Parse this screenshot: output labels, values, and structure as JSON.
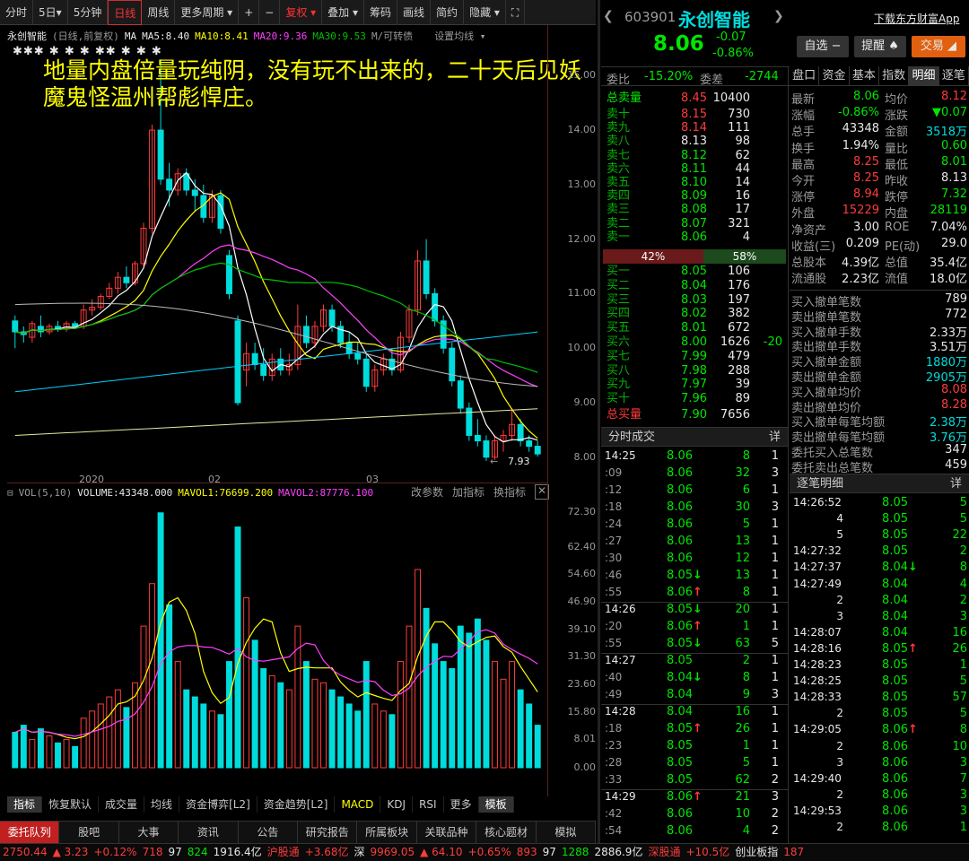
{
  "toolbar": [
    "分时",
    "5日▾",
    "5分钟",
    "日线",
    "周线",
    "更多周期 ▾",
    "+",
    "−",
    "复权 ▾",
    "叠加 ▾",
    "筹码",
    "画线",
    "简约",
    "隐藏 ▾",
    "⛶"
  ],
  "chart": {
    "name": "永创智能",
    "mode": "(日线,前复权)",
    "ma_label": "MA",
    "ma5": "MA5:8.40",
    "ma10": "MA10:8.41",
    "ma20": "MA20:9.36",
    "ma30": "MA30:9.53",
    "convert": "M/可转债",
    "settings": "设置均线 ▾",
    "markers": "✱✱✱ ✱ ✱ ✱ ✱✱ ✱ ✱ ✱",
    "overlay_text": "地量内盘倍量玩纯阴，没有玩不出来的，二十天后见妖魔鬼怪温州帮彪悍庄。",
    "price_ticks": [
      "15.00",
      "14.00",
      "13.00",
      "12.00",
      "11.00",
      "10.00",
      "9.00",
      "8.00"
    ],
    "low_label": "7.93",
    "date_labels": [
      "2020",
      "02",
      "03"
    ],
    "colors": {
      "up": "#ff3b3b",
      "down": "#00dcdc",
      "ma5": "#ffffff",
      "ma10": "#ffff00",
      "ma20": "#ff40ff",
      "ma30": "#00c000"
    }
  },
  "volume": {
    "label": "VOL(5,10)",
    "value": "VOLUME:43348.000",
    "mavol1": "MAVOL1:76699.200",
    "mavol2": "MAVOL2:87776.100",
    "edit": "改参数",
    "add": "加指标",
    "switch": "换指标",
    "ticks": [
      "72.30",
      "62.40",
      "54.60",
      "46.90",
      "39.10",
      "31.30",
      "23.60",
      "15.80",
      "8.01",
      "0.00"
    ]
  },
  "indicator_tabs": [
    "指标",
    "恢复默认",
    "成交量",
    "均线",
    "资金博弈[L2]",
    "资金趋势[L2]",
    "MACD",
    "KDJ",
    "RSI",
    "更多",
    "模板"
  ],
  "bottom_tabs": [
    "委托队列",
    "股吧",
    "大事",
    "资讯",
    "公告",
    "研究报告",
    "所属板块",
    "关联品种",
    "核心题材",
    "模拟"
  ],
  "status": [
    {
      "t": "2750.44",
      "c": "red"
    },
    {
      "t": "▲ 3.23",
      "c": "red"
    },
    {
      "t": "+0.12%",
      "c": "red"
    },
    {
      "t": "718",
      "c": "red"
    },
    {
      "t": "97",
      "c": "wht"
    },
    {
      "t": "824",
      "c": "grn"
    },
    {
      "t": "1916.4亿",
      "c": "wht"
    },
    {
      "t": "沪股通",
      "c": "red"
    },
    {
      "t": "+3.68亿",
      "c": "red"
    },
    {
      "t": "深",
      "c": "wht"
    },
    {
      "t": "9969.05",
      "c": "red"
    },
    {
      "t": "▲ 64.10",
      "c": "red"
    },
    {
      "t": "+0.65%",
      "c": "red"
    },
    {
      "t": "893",
      "c": "red"
    },
    {
      "t": "97",
      "c": "wht"
    },
    {
      "t": "1288",
      "c": "grn"
    },
    {
      "t": "2886.9亿",
      "c": "wht"
    },
    {
      "t": "深股通",
      "c": "red"
    },
    {
      "t": "+10.5亿",
      "c": "red"
    },
    {
      "t": "创业板指",
      "c": "wht"
    },
    {
      "t": "187",
      "c": "red"
    }
  ],
  "quote": {
    "code": "603901",
    "name": "永创智能",
    "download": "下载东方财富App",
    "price": "8.06",
    "change": "-0.07",
    "pct": "-0.86%",
    "btn_watch": "自选 −",
    "btn_alert": "提醒 ♠",
    "btn_trade": "交易 ◢",
    "weibi_label": "委比",
    "weibi": "-15.20%",
    "weicha_label": "委差",
    "weicha": "-2744"
  },
  "orderbook": {
    "total_sell": {
      "label": "总卖量",
      "price": "8.45",
      "vol": "10400"
    },
    "asks": [
      {
        "label": "卖十",
        "price": "8.15",
        "vol": "730",
        "c": "red"
      },
      {
        "label": "卖九",
        "price": "8.14",
        "vol": "111",
        "c": "red"
      },
      {
        "label": "卖八",
        "price": "8.13",
        "vol": "98",
        "c": "wht"
      },
      {
        "label": "卖七",
        "price": "8.12",
        "vol": "62",
        "c": "grn"
      },
      {
        "label": "卖六",
        "price": "8.11",
        "vol": "44",
        "c": "grn"
      },
      {
        "label": "卖五",
        "price": "8.10",
        "vol": "14",
        "c": "grn"
      },
      {
        "label": "卖四",
        "price": "8.09",
        "vol": "16",
        "c": "grn"
      },
      {
        "label": "卖三",
        "price": "8.08",
        "vol": "17",
        "c": "grn"
      },
      {
        "label": "卖二",
        "price": "8.07",
        "vol": "321",
        "c": "grn"
      },
      {
        "label": "卖一",
        "price": "8.06",
        "vol": "4",
        "c": "grn"
      }
    ],
    "bar_left": "42%",
    "bar_right": "58%",
    "bids": [
      {
        "label": "买一",
        "price": "8.05",
        "vol": "106",
        "c": "grn",
        "x": ""
      },
      {
        "label": "买二",
        "price": "8.04",
        "vol": "176",
        "c": "grn",
        "x": ""
      },
      {
        "label": "买三",
        "price": "8.03",
        "vol": "197",
        "c": "grn",
        "x": ""
      },
      {
        "label": "买四",
        "price": "8.02",
        "vol": "382",
        "c": "grn",
        "x": ""
      },
      {
        "label": "买五",
        "price": "8.01",
        "vol": "672",
        "c": "grn",
        "x": ""
      },
      {
        "label": "买六",
        "price": "8.00",
        "vol": "1626",
        "c": "grn",
        "x": "-20"
      },
      {
        "label": "买七",
        "price": "7.99",
        "vol": "479",
        "c": "grn",
        "x": ""
      },
      {
        "label": "买八",
        "price": "7.98",
        "vol": "288",
        "c": "grn",
        "x": ""
      },
      {
        "label": "买九",
        "price": "7.97",
        "vol": "39",
        "c": "grn",
        "x": ""
      },
      {
        "label": "买十",
        "price": "7.96",
        "vol": "89",
        "c": "grn",
        "x": ""
      }
    ],
    "total_buy": {
      "label": "总买量",
      "price": "7.90",
      "vol": "7656"
    }
  },
  "stat_tabs": [
    "盘口",
    "资金",
    "基本",
    "指数",
    "明细",
    "逐笔"
  ],
  "stats": [
    {
      "l1": "最新",
      "v1": "8.06",
      "c1": "grn",
      "l2": "均价",
      "v2": "8.12",
      "c2": "red"
    },
    {
      "l1": "涨幅",
      "v1": "-0.86%",
      "c1": "grn",
      "l2": "涨跌",
      "v2": "▼0.07",
      "c2": "grn"
    },
    {
      "l1": "总手",
      "v1": "43348",
      "c1": "wht",
      "l2": "金额",
      "v2": "3518万",
      "c2": "cyn"
    },
    {
      "l1": "换手",
      "v1": "1.94%",
      "c1": "wht",
      "l2": "量比",
      "v2": "0.60",
      "c2": "grn"
    },
    {
      "l1": "最高",
      "v1": "8.25",
      "c1": "red",
      "l2": "最低",
      "v2": "8.01",
      "c2": "grn"
    },
    {
      "l1": "今开",
      "v1": "8.25",
      "c1": "red",
      "l2": "昨收",
      "v2": "8.13",
      "c2": "wht"
    },
    {
      "l1": "涨停",
      "v1": "8.94",
      "c1": "red",
      "l2": "跌停",
      "v2": "7.32",
      "c2": "grn"
    },
    {
      "l1": "外盘",
      "v1": "15229",
      "c1": "red",
      "l2": "内盘",
      "v2": "28119",
      "c2": "grn"
    },
    {
      "l1": "净资产",
      "v1": "3.00",
      "c1": "wht",
      "l2": "ROE",
      "v2": "7.04%",
      "c2": "wht"
    },
    {
      "l1": "收益(三)",
      "v1": "0.209",
      "c1": "wht",
      "l2": "PE(动)",
      "v2": "29.0",
      "c2": "wht"
    },
    {
      "l1": "总股本",
      "v1": "4.39亿",
      "c1": "wht",
      "l2": "总值",
      "v2": "35.4亿",
      "c2": "wht"
    },
    {
      "l1": "流通股",
      "v1": "2.23亿",
      "c1": "wht",
      "l2": "流值",
      "v2": "18.0亿",
      "c2": "wht"
    }
  ],
  "cancel_stats": [
    {
      "l": "买入撤单笔数",
      "v": "789",
      "c": "wht"
    },
    {
      "l": "卖出撤单笔数",
      "v": "772",
      "c": "wht"
    },
    {
      "l": "买入撤单手数",
      "v": "2.33万",
      "c": "wht"
    },
    {
      "l": "卖出撤单手数",
      "v": "3.51万",
      "c": "wht"
    },
    {
      "l": "买入撤单金额",
      "v": "1880万",
      "c": "cyn"
    },
    {
      "l": "卖出撤单金额",
      "v": "2905万",
      "c": "cyn"
    },
    {
      "l": "买入撤单均价",
      "v": "8.08",
      "c": "red"
    },
    {
      "l": "卖出撤单均价",
      "v": "8.28",
      "c": "red"
    },
    {
      "l": "买入撤单每笔均额",
      "v": "2.38万",
      "c": "cyn"
    },
    {
      "l": "卖出撤单每笔均额",
      "v": "3.76万",
      "c": "cyn"
    },
    {
      "l": "委托买入总笔数",
      "v": "347",
      "c": "wht"
    },
    {
      "l": "委托卖出总笔数",
      "v": "459",
      "c": "wht"
    }
  ],
  "ticks_header": {
    "title": "分时成交",
    "detail": "详"
  },
  "ticks": [
    {
      "t": "14:25",
      "p": "8.06",
      "c": "grn",
      "v": "8",
      "n": "1",
      "a": ""
    },
    {
      "t": ":09",
      "p": "8.06",
      "c": "grn",
      "v": "32",
      "n": "3",
      "a": ""
    },
    {
      "t": ":12",
      "p": "8.06",
      "c": "grn",
      "v": "6",
      "n": "1",
      "a": ""
    },
    {
      "t": ":18",
      "p": "8.06",
      "c": "grn",
      "v": "30",
      "n": "3",
      "a": ""
    },
    {
      "t": ":24",
      "p": "8.06",
      "c": "grn",
      "v": "5",
      "n": "1",
      "a": ""
    },
    {
      "t": ":27",
      "p": "8.06",
      "c": "grn",
      "v": "13",
      "n": "1",
      "a": ""
    },
    {
      "t": ":30",
      "p": "8.06",
      "c": "grn",
      "v": "12",
      "n": "1",
      "a": ""
    },
    {
      "t": ":46",
      "p": "8.05",
      "c": "grn",
      "v": "13",
      "n": "1",
      "a": "↓"
    },
    {
      "t": ":55",
      "p": "8.06",
      "c": "grn",
      "v": "8",
      "n": "1",
      "a": "↑"
    },
    {
      "t": "14:26",
      "p": "8.05",
      "c": "grn",
      "v": "20",
      "n": "1",
      "a": "↓"
    },
    {
      "t": ":20",
      "p": "8.06",
      "c": "grn",
      "v": "1",
      "n": "1",
      "a": "↑"
    },
    {
      "t": ":55",
      "p": "8.05",
      "c": "grn",
      "v": "63",
      "n": "5",
      "a": "↓"
    },
    {
      "t": "14:27",
      "p": "8.05",
      "c": "grn",
      "v": "2",
      "n": "1",
      "a": ""
    },
    {
      "t": ":40",
      "p": "8.04",
      "c": "grn",
      "v": "8",
      "n": "1",
      "a": "↓"
    },
    {
      "t": ":49",
      "p": "8.04",
      "c": "grn",
      "v": "9",
      "n": "3",
      "a": ""
    },
    {
      "t": "14:28",
      "p": "8.04",
      "c": "grn",
      "v": "16",
      "n": "1",
      "a": ""
    },
    {
      "t": ":18",
      "p": "8.05",
      "c": "grn",
      "v": "26",
      "n": "1",
      "a": "↑"
    },
    {
      "t": ":23",
      "p": "8.05",
      "c": "grn",
      "v": "1",
      "n": "1",
      "a": ""
    },
    {
      "t": ":28",
      "p": "8.05",
      "c": "grn",
      "v": "5",
      "n": "1",
      "a": ""
    },
    {
      "t": ":33",
      "p": "8.05",
      "c": "grn",
      "v": "62",
      "n": "2",
      "a": ""
    },
    {
      "t": "14:29",
      "p": "8.06",
      "c": "grn",
      "v": "21",
      "n": "3",
      "a": "↑"
    },
    {
      "t": ":42",
      "p": "8.06",
      "c": "grn",
      "v": "10",
      "n": "2",
      "a": ""
    },
    {
      "t": ":54",
      "p": "8.06",
      "c": "grn",
      "v": "4",
      "n": "2",
      "a": ""
    }
  ],
  "trades_header": {
    "title": "逐笔明细",
    "detail": "详"
  },
  "trades": [
    {
      "t": "14:26:52",
      "p": "8.05",
      "v": "5",
      "a": ""
    },
    {
      "t": "4",
      "p": "8.05",
      "v": "5",
      "a": ""
    },
    {
      "t": "5",
      "p": "8.05",
      "v": "22",
      "a": ""
    },
    {
      "t": "14:27:32",
      "p": "8.05",
      "v": "2",
      "a": ""
    },
    {
      "t": "14:27:37",
      "p": "8.04",
      "v": "8",
      "a": "↓"
    },
    {
      "t": "14:27:49",
      "p": "8.04",
      "v": "4",
      "a": ""
    },
    {
      "t": "2",
      "p": "8.04",
      "v": "2",
      "a": ""
    },
    {
      "t": "3",
      "p": "8.04",
      "v": "3",
      "a": ""
    },
    {
      "t": "14:28:07",
      "p": "8.04",
      "v": "16",
      "a": ""
    },
    {
      "t": "14:28:16",
      "p": "8.05",
      "v": "26",
      "a": "↑"
    },
    {
      "t": "14:28:23",
      "p": "8.05",
      "v": "1",
      "a": ""
    },
    {
      "t": "14:28:25",
      "p": "8.05",
      "v": "5",
      "a": ""
    },
    {
      "t": "14:28:33",
      "p": "8.05",
      "v": "57",
      "a": ""
    },
    {
      "t": "2",
      "p": "8.05",
      "v": "5",
      "a": ""
    },
    {
      "t": "14:29:05",
      "p": "8.06",
      "v": "8",
      "a": "↑"
    },
    {
      "t": "2",
      "p": "8.06",
      "v": "10",
      "a": ""
    },
    {
      "t": "3",
      "p": "8.06",
      "v": "3",
      "a": ""
    },
    {
      "t": "14:29:40",
      "p": "8.06",
      "v": "7",
      "a": ""
    },
    {
      "t": "2",
      "p": "8.06",
      "v": "3",
      "a": ""
    },
    {
      "t": "14:29:53",
      "p": "8.06",
      "v": "3",
      "a": ""
    },
    {
      "t": "2",
      "p": "8.06",
      "v": "1",
      "a": ""
    }
  ],
  "candles": [
    [
      10.5,
      10.6,
      10.0,
      10.3
    ],
    [
      10.3,
      10.4,
      10.1,
      10.25
    ],
    [
      10.2,
      10.5,
      10.1,
      10.45
    ],
    [
      10.4,
      10.6,
      10.2,
      10.3
    ],
    [
      10.3,
      10.45,
      10.25,
      10.4
    ],
    [
      10.4,
      10.5,
      10.3,
      10.35
    ],
    [
      10.35,
      10.5,
      10.3,
      10.45
    ],
    [
      10.45,
      10.5,
      10.35,
      10.4
    ],
    [
      10.4,
      10.8,
      10.35,
      10.7
    ],
    [
      10.7,
      10.9,
      10.6,
      10.75
    ],
    [
      10.75,
      11.0,
      10.7,
      10.95
    ],
    [
      10.95,
      11.2,
      10.9,
      11.1
    ],
    [
      11.1,
      11.4,
      11.0,
      11.3
    ],
    [
      11.3,
      11.5,
      11.1,
      11.2
    ],
    [
      11.2,
      11.6,
      11.15,
      11.55
    ],
    [
      11.55,
      12.3,
      11.5,
      12.2
    ],
    [
      12.2,
      14.1,
      12.1,
      14.0
    ],
    [
      14.0,
      15.3,
      13.0,
      13.1
    ],
    [
      13.1,
      13.4,
      12.6,
      12.9
    ],
    [
      12.9,
      13.3,
      12.8,
      13.2
    ],
    [
      13.2,
      13.3,
      12.8,
      12.9
    ],
    [
      12.9,
      13.1,
      12.5,
      12.8
    ],
    [
      12.8,
      13.0,
      12.3,
      12.4
    ],
    [
      12.4,
      12.9,
      12.3,
      12.8
    ],
    [
      12.8,
      12.9,
      12.1,
      12.2
    ],
    [
      11.7,
      11.8,
      10.9,
      11.0
    ],
    [
      10.5,
      10.6,
      8.95,
      9.0
    ],
    [
      9.6,
      10.1,
      9.3,
      9.9
    ],
    [
      9.9,
      10.1,
      9.6,
      9.7
    ],
    [
      9.7,
      10.0,
      9.4,
      9.5
    ],
    [
      9.5,
      9.9,
      9.4,
      9.8
    ],
    [
      9.8,
      10.0,
      9.5,
      9.6
    ],
    [
      9.6,
      9.9,
      9.5,
      9.7
    ],
    [
      9.7,
      10.8,
      9.6,
      10.4
    ],
    [
      10.4,
      10.6,
      10.0,
      10.1
    ],
    [
      10.1,
      10.5,
      10.0,
      10.4
    ],
    [
      10.4,
      10.8,
      10.3,
      10.7
    ],
    [
      10.7,
      10.8,
      10.3,
      10.4
    ],
    [
      10.4,
      10.5,
      10.0,
      10.1
    ],
    [
      10.1,
      10.3,
      9.8,
      9.9
    ],
    [
      9.9,
      10.1,
      9.7,
      9.8
    ],
    [
      9.8,
      9.9,
      9.2,
      9.3
    ],
    [
      9.3,
      9.7,
      9.2,
      9.6
    ],
    [
      9.6,
      9.9,
      9.5,
      9.8
    ],
    [
      9.8,
      10.0,
      9.5,
      9.6
    ],
    [
      9.6,
      10.3,
      9.55,
      10.2
    ],
    [
      10.2,
      10.8,
      10.1,
      10.7
    ],
    [
      10.7,
      11.8,
      10.6,
      11.6
    ],
    [
      11.6,
      12.0,
      10.9,
      11.0
    ],
    [
      11.0,
      11.1,
      10.4,
      10.5
    ],
    [
      10.5,
      10.6,
      9.9,
      10.0
    ],
    [
      10.0,
      10.1,
      9.3,
      9.4
    ],
    [
      9.4,
      9.5,
      8.8,
      8.9
    ],
    [
      8.9,
      9.0,
      8.3,
      8.4
    ],
    [
      8.4,
      8.7,
      8.2,
      8.3
    ],
    [
      8.3,
      8.4,
      7.93,
      8.0
    ],
    [
      8.0,
      8.4,
      7.95,
      8.3
    ],
    [
      8.3,
      8.5,
      8.1,
      8.4
    ],
    [
      8.4,
      8.9,
      8.3,
      8.6
    ],
    [
      8.6,
      8.7,
      8.2,
      8.3
    ],
    [
      8.3,
      8.4,
      8.1,
      8.2
    ],
    [
      8.2,
      8.3,
      8.01,
      8.06
    ]
  ],
  "vols": [
    10,
    12,
    8,
    11,
    9,
    7,
    8,
    6,
    14,
    16,
    18,
    20,
    22,
    17,
    24,
    40,
    52,
    72,
    46,
    30,
    22,
    20,
    18,
    16,
    15,
    30,
    68,
    48,
    36,
    28,
    26,
    24,
    22,
    40,
    30,
    25,
    24,
    22,
    20,
    18,
    16,
    30,
    18,
    16,
    15,
    30,
    40,
    56,
    45,
    35,
    30,
    28,
    40,
    38,
    42,
    36,
    30,
    25,
    30,
    22,
    18,
    12
  ]
}
